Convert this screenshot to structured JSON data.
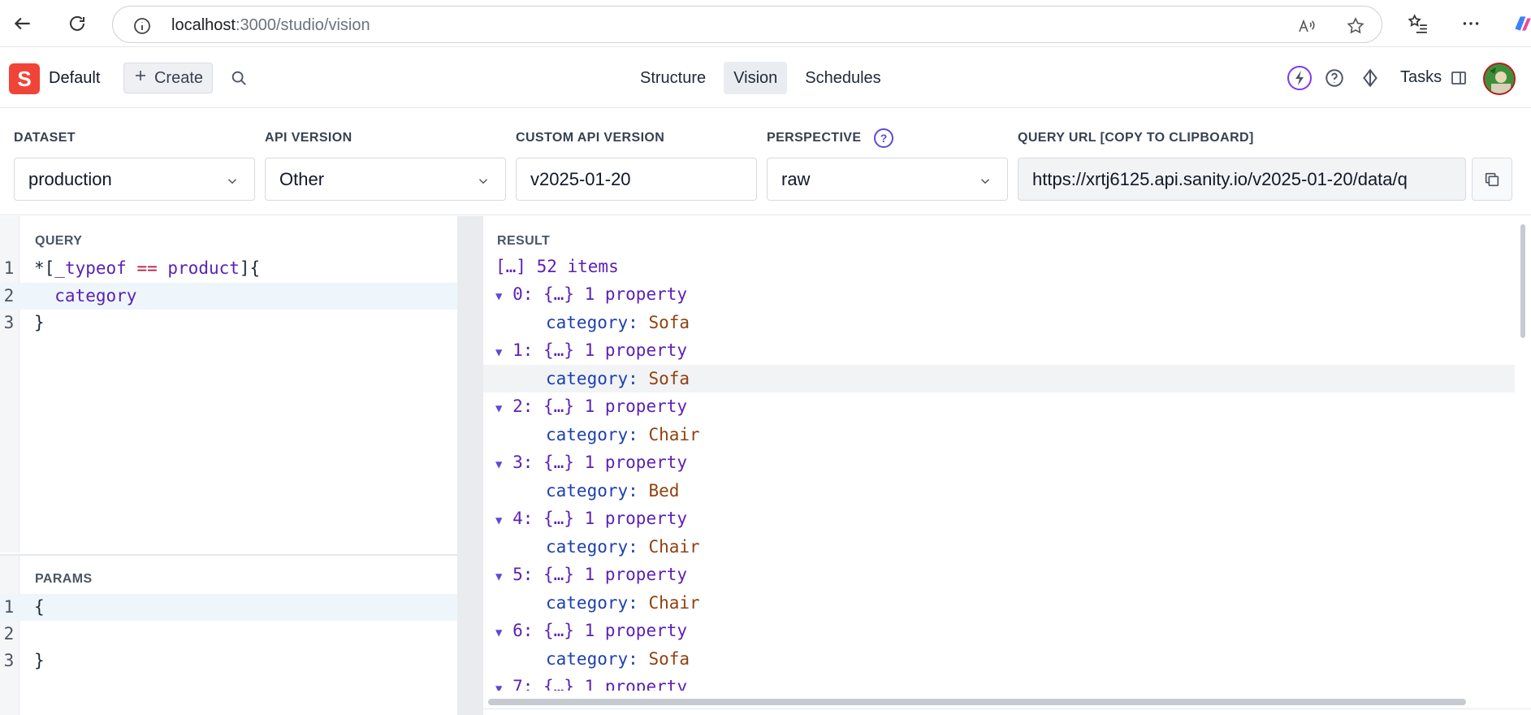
{
  "browser": {
    "url_host": "localhost",
    "url_path": ":3000/studio/vision"
  },
  "header": {
    "logo_letter": "S",
    "workspace": "Default",
    "create_label": "Create",
    "tabs": [
      "Structure",
      "Vision",
      "Schedules"
    ],
    "active_tab": "Vision",
    "tasks_label": "Tasks"
  },
  "controls": {
    "dataset_label": "DATASET",
    "dataset_value": "production",
    "api_version_label": "API VERSION",
    "api_version_value": "Other",
    "custom_api_label": "CUSTOM API VERSION",
    "custom_api_value": "v2025-01-20",
    "perspective_label": "PERSPECTIVE",
    "perspective_value": "raw",
    "query_url_label": "QUERY URL [COPY TO CLIPBOARD]",
    "query_url_value": "https://xrtj6125.api.sanity.io/v2025-01-20/data/q"
  },
  "query": {
    "label": "QUERY",
    "lines": [
      "1",
      "2",
      "3"
    ],
    "line1_star": "*[",
    "line1_kw1": "_typeof",
    "line1_op": " == ",
    "line1_kw2": "product",
    "line1_end": "]{",
    "line2": "  category",
    "line3": "}"
  },
  "params": {
    "label": "PARAMS",
    "lines": [
      "1",
      "2",
      "3"
    ],
    "line1": "{",
    "line2": "",
    "line3": "}"
  },
  "result": {
    "label": "RESULT",
    "summary": "[…] 52 items",
    "items": [
      {
        "header": "0: {…} 1 property",
        "key": "category:",
        "value": "Sofa"
      },
      {
        "header": "1: {…} 1 property",
        "key": "category:",
        "value": "Sofa"
      },
      {
        "header": "2: {…} 1 property",
        "key": "category:",
        "value": "Chair"
      },
      {
        "header": "3: {…} 1 property",
        "key": "category:",
        "value": "Bed"
      },
      {
        "header": "4: {…} 1 property",
        "key": "category:",
        "value": "Chair"
      },
      {
        "header": "5: {…} 1 property",
        "key": "category:",
        "value": "Chair"
      },
      {
        "header": "6: {…} 1 property",
        "key": "category:",
        "value": "Sofa"
      },
      {
        "header": "7: {…} 1 property",
        "key": "",
        "value": ""
      }
    ]
  }
}
